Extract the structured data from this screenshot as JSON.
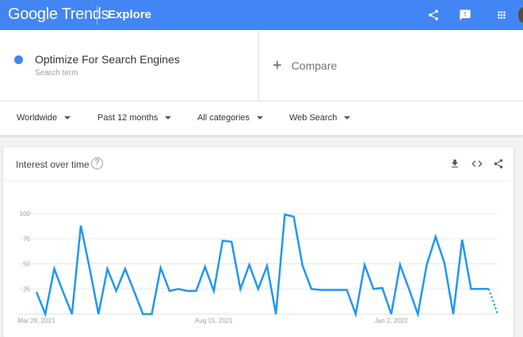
{
  "header": {
    "logo_google": "Google",
    "logo_trends": "Trends",
    "section": "Explore"
  },
  "search_term": {
    "name": "Optimize For Search Engines",
    "label": "Search term",
    "color": "#4285f4"
  },
  "compare": {
    "label": "Compare"
  },
  "filters": [
    {
      "label": "Worldwide"
    },
    {
      "label": "Past 12 months"
    },
    {
      "label": "All categories"
    },
    {
      "label": "Web Search"
    }
  ],
  "card": {
    "title": "Interest over time",
    "help_icon": "question-mark-icon",
    "actions": [
      "download-icon",
      "embed-icon",
      "share-icon"
    ]
  },
  "chart_data": {
    "type": "line",
    "title": "Interest over time",
    "ylim": [
      0,
      100
    ],
    "y_ticks": [
      25,
      50,
      75,
      100
    ],
    "x_labels": [
      {
        "label": "Mar 28, 2021",
        "index": 0
      },
      {
        "label": "Aug 15, 2021",
        "index": 20
      },
      {
        "label": "Jan 2, 2022",
        "index": 40
      }
    ],
    "series": [
      {
        "color": "#2196f3",
        "values": [
          22,
          0,
          45,
          22,
          0,
          88,
          45,
          0,
          45,
          23,
          45,
          23,
          0,
          0,
          46,
          23,
          25,
          23,
          23,
          47,
          23,
          73,
          72,
          25,
          49,
          25,
          48,
          0,
          99,
          97,
          48,
          25,
          24,
          24,
          24,
          24,
          0,
          49,
          25,
          26,
          0,
          49,
          25,
          0,
          49,
          77,
          51,
          0,
          74,
          25,
          25,
          25,
          0
        ],
        "partial_from_index": 51
      }
    ]
  }
}
